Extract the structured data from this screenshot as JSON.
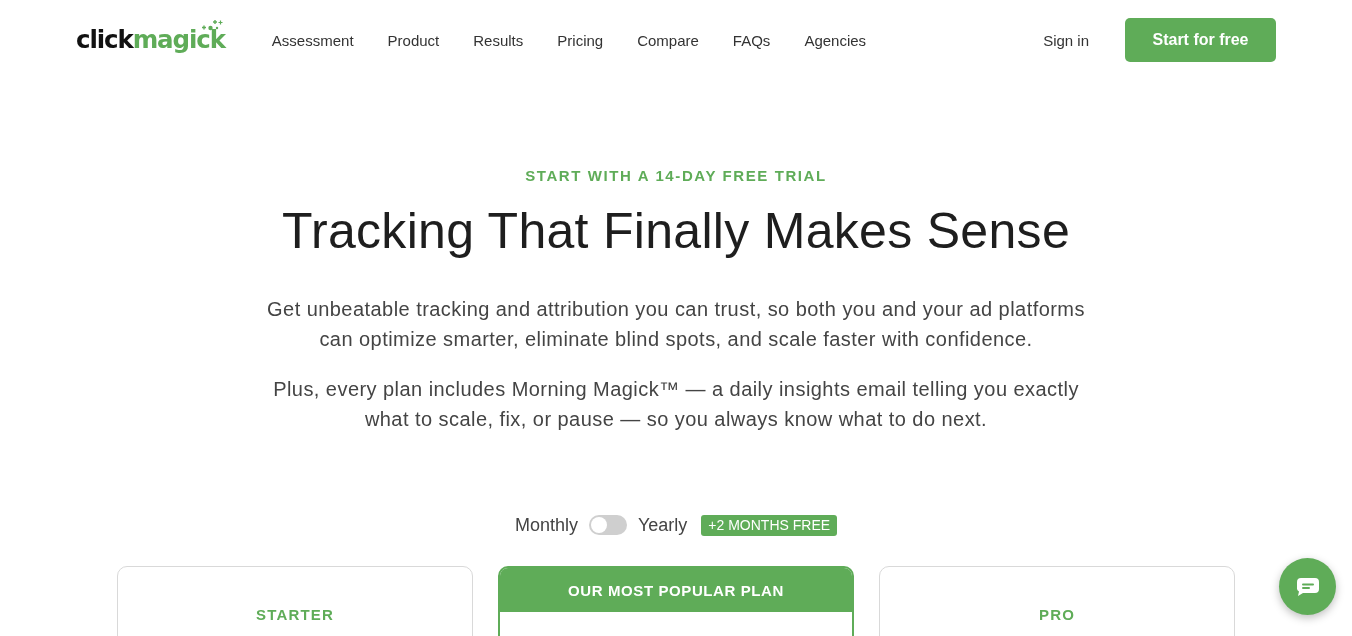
{
  "header": {
    "logo": {
      "dark_part": "click",
      "green_part": "magick"
    },
    "nav_links": [
      "Assessment",
      "Product",
      "Results",
      "Pricing",
      "Compare",
      "FAQs",
      "Agencies"
    ],
    "sign_in": "Sign in",
    "cta": "Start for free"
  },
  "hero": {
    "eyebrow": "START WITH A 14-DAY FREE TRIAL",
    "title": "Tracking That Finally Makes Sense",
    "paragraphs": [
      "Get unbeatable tracking and attribution you can trust, so both you and your ad platforms can optimize smarter, eliminate blind spots, and scale faster with confidence.",
      "Plus, every plan includes Morning Magick™ — a daily insights email telling you exactly what to scale, fix, or pause — so you always know what to do next."
    ]
  },
  "billing_toggle": {
    "left_label": "Monthly",
    "right_label": "Yearly",
    "on": false,
    "badge": "+2 MONTHS FREE"
  },
  "plans": [
    {
      "kind": "standard",
      "name": "STARTER"
    },
    {
      "kind": "featured",
      "banner": "OUR MOST POPULAR PLAN"
    },
    {
      "kind": "standard",
      "name": "PRO"
    }
  ]
}
